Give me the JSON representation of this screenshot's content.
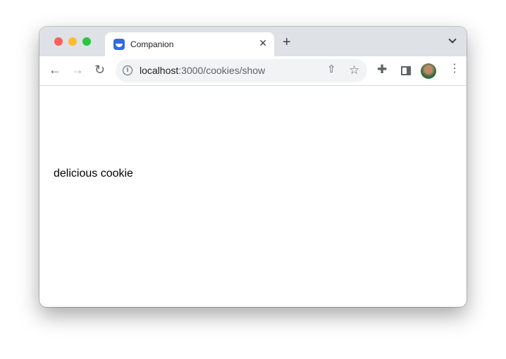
{
  "tab": {
    "title": "Companion",
    "favicon": "companion-icon"
  },
  "toolbar": {
    "url_host": "localhost",
    "url_path": ":3000/cookies/show"
  },
  "page": {
    "text": "delicious cookie"
  }
}
